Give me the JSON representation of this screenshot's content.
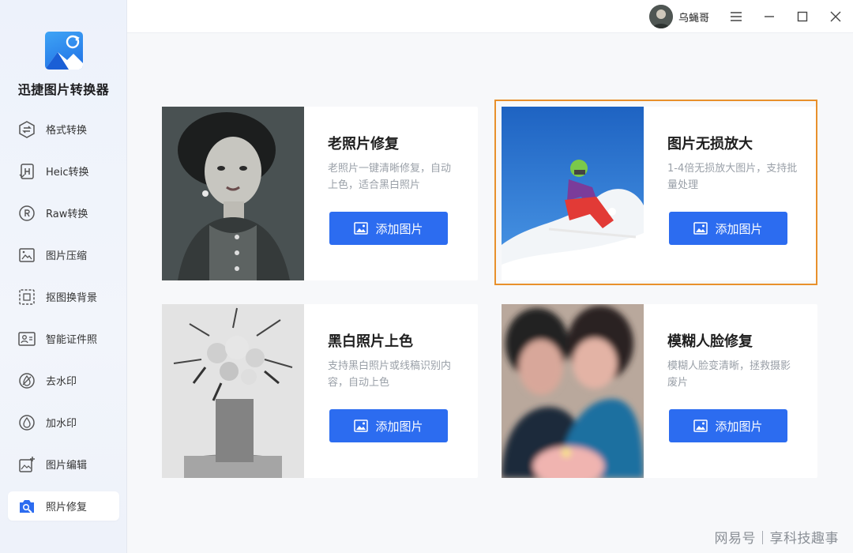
{
  "app": {
    "title": "迅捷图片转换器"
  },
  "sidebar": {
    "items": [
      {
        "label": "格式转换",
        "icon": "format-convert-icon"
      },
      {
        "label": "Heic转换",
        "icon": "heic-icon"
      },
      {
        "label": "Raw转换",
        "icon": "raw-icon"
      },
      {
        "label": "图片压缩",
        "icon": "compress-icon"
      },
      {
        "label": "抠图换背景",
        "icon": "cutout-icon"
      },
      {
        "label": "智能证件照",
        "icon": "id-photo-icon"
      },
      {
        "label": "去水印",
        "icon": "remove-watermark-icon"
      },
      {
        "label": "加水印",
        "icon": "add-watermark-icon"
      },
      {
        "label": "图片编辑",
        "icon": "image-edit-icon"
      },
      {
        "label": "照片修复",
        "icon": "photo-repair-icon",
        "active": true
      }
    ]
  },
  "titlebar": {
    "username": "乌蝇哥"
  },
  "cards": [
    {
      "title": "老照片修复",
      "desc": "老照片一键清晰修复，自动上色，适合黑白照片",
      "button": "添加图片"
    },
    {
      "title": "图片无损放大",
      "desc": "1-4倍无损放大图片，支持批量处理",
      "button": "添加图片",
      "selected": true
    },
    {
      "title": "黑白照片上色",
      "desc": "支持黑白照片或线稿识别内容，自动上色",
      "button": "添加图片"
    },
    {
      "title": "模糊人脸修复",
      "desc": "模糊人脸变清晰，拯救摄影废片",
      "button": "添加图片"
    }
  ],
  "watermark": "网易号｜享科技趣事",
  "colors": {
    "accent": "#2c6cf0",
    "selected_border": "#e8902c",
    "sidebar_bg": "#edf2fb"
  }
}
